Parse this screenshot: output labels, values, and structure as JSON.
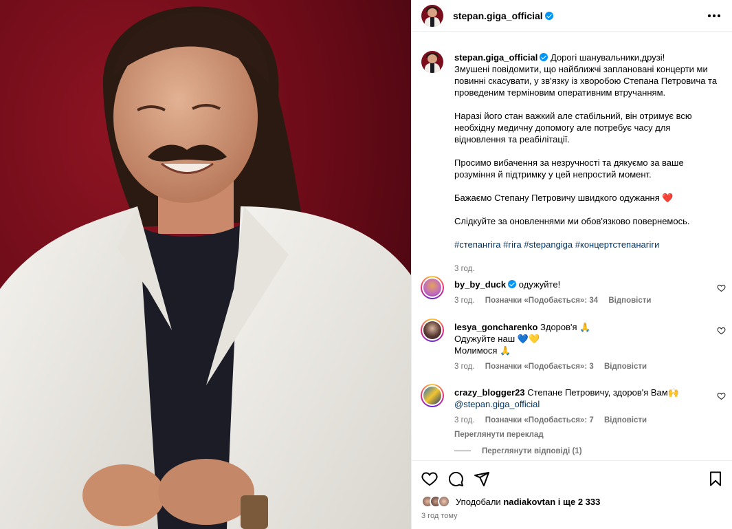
{
  "header": {
    "username": "stepan.giga_official"
  },
  "caption": {
    "username": "stepan.giga_official",
    "text": "Дорогі шанувальники,друзі!\nЗмушені повідомити, що найближчі заплановані концерти ми повинні скасувати, у зв'язку із хворобою Степана Петровича та проведеним терміновим оперативним втручанням.\n\nНаразі його стан важкий але стабільний, він отримує всю необхідну медичну допомогу але потребує часу для відновлення та реабілітації.\n\nПросимо вибачення за незручності та дякуємо за ваше розуміння й підтримку у цей непростий момент.\n\nБажаємо Степану Петровичу швидкого одужання ❤️\n\nСлідкуйте за оновленнями ми обов'язково повернемось.",
    "hashtags": "#степангіга #гіга #stepangiga #концертстепанагіги",
    "time": "3 год."
  },
  "comments": [
    {
      "username": "by_by_duck",
      "text": "одужуйте!",
      "time": "3 год.",
      "likes": "Позначки «Подобається»: 34",
      "reply": "Відповісти"
    },
    {
      "username": "lesya_goncharenko",
      "text": "Здоров'я 🙏\nОдужуйте наш 💙💛\nМолимося 🙏",
      "time": "3 год.",
      "likes": "Позначки «Подобається»: 3",
      "reply": "Відповісти"
    },
    {
      "username": "crazy_blogger23",
      "text": "Степане Петровичу, здоров'я Вам🙌",
      "mention": "@stepan.giga_official",
      "time": "3 год.",
      "likes": "Позначки «Подобається»: 7",
      "reply": "Відповісти",
      "translate": "Переглянути переклад"
    }
  ],
  "view_replies": "Переглянути відповіді (1)",
  "likes_line": {
    "prefix": "Уподобали ",
    "user": "nadiakovtan",
    "suffix": " і ще 2 333"
  },
  "post_time": "3 год тому",
  "colors": {
    "accent": "#0095f6",
    "link": "#00376b",
    "muted": "#737373",
    "background_photo": "#6a0a18"
  }
}
